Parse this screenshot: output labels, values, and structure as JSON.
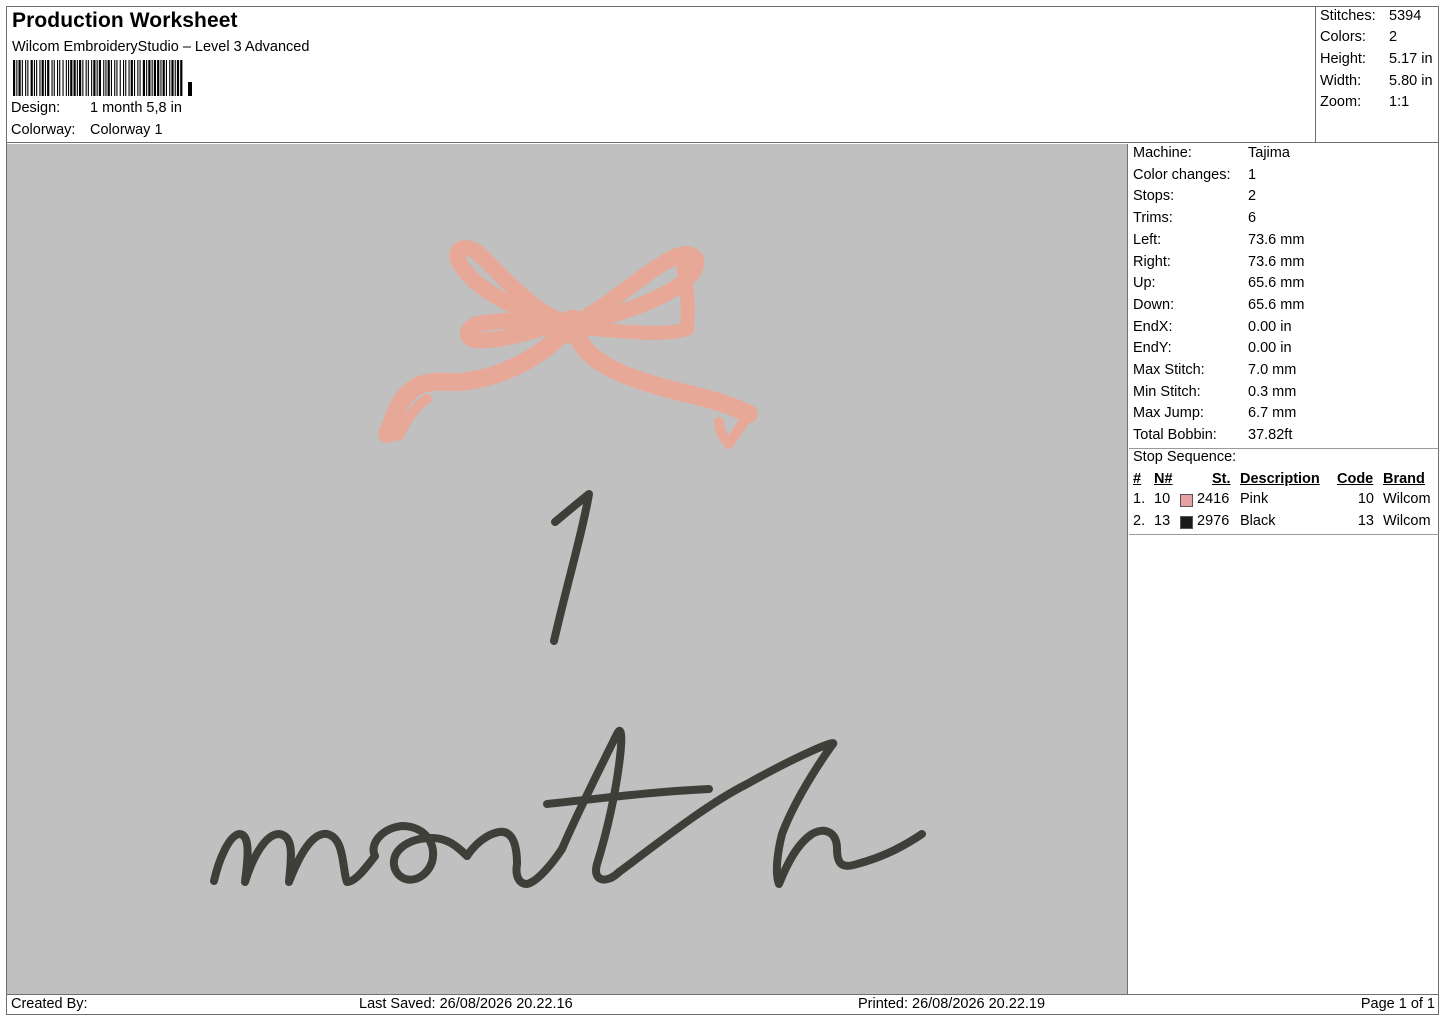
{
  "header": {
    "title": "Production Worksheet",
    "subtitle": "Wilcom EmbroideryStudio – Level 3 Advanced",
    "design_label": "Design:",
    "design_value": "1 month 5,8 in",
    "colorway_label": "Colorway:",
    "colorway_value": "Colorway 1"
  },
  "stats": {
    "stitches_label": "Stitches:",
    "stitches": "5394",
    "colors_label": "Colors:",
    "colors": "2",
    "height_label": "Height:",
    "height": "5.17 in",
    "width_label": "Width:",
    "width": "5.80 in",
    "zoom_label": "Zoom:",
    "zoom": "1:1"
  },
  "machine_info": [
    {
      "label": "Machine:",
      "value": "Tajima"
    },
    {
      "label": "Color changes:",
      "value": "1"
    },
    {
      "label": "Stops:",
      "value": "2"
    },
    {
      "label": "Trims:",
      "value": "6"
    },
    {
      "label": "Left:",
      "value": "73.6 mm"
    },
    {
      "label": "Right:",
      "value": "73.6 mm"
    },
    {
      "label": "Up:",
      "value": "65.6 mm"
    },
    {
      "label": "Down:",
      "value": "65.6 mm"
    },
    {
      "label": "EndX:",
      "value": "0.00 in"
    },
    {
      "label": "EndY:",
      "value": "0.00 in"
    },
    {
      "label": "Max Stitch:",
      "value": "7.0 mm"
    },
    {
      "label": "Min Stitch:",
      "value": "0.3 mm"
    },
    {
      "label": "Max Jump:",
      "value": "6.7 mm"
    },
    {
      "label": "Total Bobbin:",
      "value": "37.82ft"
    }
  ],
  "stop_sequence": {
    "title": "Stop Sequence:",
    "headers": {
      "num": "#",
      "needle": "N#",
      "stitches": "St.",
      "description": "Description",
      "code": "Code",
      "brand": "Brand"
    },
    "rows": [
      {
        "num": "1.",
        "needle": "10",
        "color": "#e8a0a0",
        "stitches": "2416",
        "description": "Pink",
        "code": "10",
        "brand": "Wilcom"
      },
      {
        "num": "2.",
        "needle": "13",
        "color": "#1a1a1a",
        "stitches": "2976",
        "description": "Black",
        "code": "13",
        "brand": "Wilcom"
      }
    ]
  },
  "design_preview": {
    "background": "#c0c0c0",
    "bow_color": "#e8a898",
    "text_color": "#3d3f38",
    "number_text": "1",
    "word_text": "month"
  },
  "footer": {
    "created_by": "Created By:",
    "last_saved": "Last Saved: 26/08/2026 20.22.16",
    "printed": "Printed: 26/08/2026 20.22.19",
    "page": "Page 1 of 1"
  }
}
